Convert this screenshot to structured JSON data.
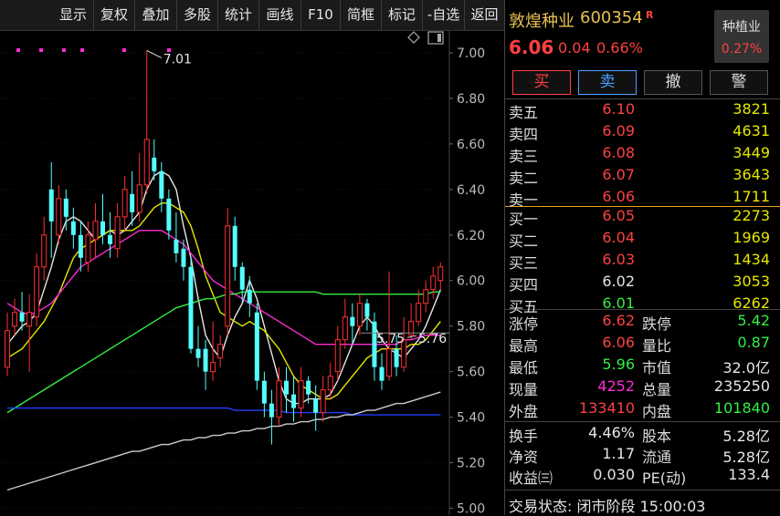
{
  "toolbar": {
    "items": [
      "显示",
      "复权",
      "叠加",
      "多股",
      "统计",
      "画线",
      "F10",
      "简框",
      "标记",
      "-自选",
      "返回"
    ]
  },
  "chart_data": {
    "type": "candlestick",
    "y_ticks": [
      "7.00",
      "6.80",
      "6.60",
      "6.40",
      "6.20",
      "6.00",
      "5.80",
      "5.60",
      "5.40",
      "5.20",
      "5.00"
    ],
    "ylim": [
      4.97,
      7.1
    ],
    "annotations": {
      "high_label": "7.01",
      "low_label_left": "5.75",
      "low_label_right": "5.76"
    },
    "candles": [
      {
        "o": 5.62,
        "c": 5.78,
        "h": 5.86,
        "l": 5.58
      },
      {
        "o": 5.8,
        "c": 5.86,
        "h": 5.92,
        "l": 5.76
      },
      {
        "o": 5.86,
        "c": 5.82,
        "h": 5.95,
        "l": 5.78
      },
      {
        "o": 5.8,
        "c": 5.86,
        "h": 5.94,
        "l": 5.6
      },
      {
        "o": 5.84,
        "c": 6.06,
        "h": 6.12,
        "l": 5.8
      },
      {
        "o": 6.06,
        "c": 6.2,
        "h": 6.28,
        "l": 6.0
      },
      {
        "o": 6.4,
        "c": 6.26,
        "h": 6.52,
        "l": 6.1
      },
      {
        "o": 6.2,
        "c": 6.36,
        "h": 6.42,
        "l": 6.16
      },
      {
        "o": 6.36,
        "c": 6.28,
        "h": 6.4,
        "l": 6.22
      },
      {
        "o": 6.26,
        "c": 6.2,
        "h": 6.32,
        "l": 6.14
      },
      {
        "o": 6.2,
        "c": 6.1,
        "h": 6.26,
        "l": 6.04
      },
      {
        "o": 6.08,
        "c": 6.2,
        "h": 6.26,
        "l": 6.04
      },
      {
        "o": 6.18,
        "c": 6.26,
        "h": 6.34,
        "l": 6.1
      },
      {
        "o": 6.26,
        "c": 6.2,
        "h": 6.38,
        "l": 6.16
      },
      {
        "o": 6.2,
        "c": 6.16,
        "h": 6.3,
        "l": 6.1
      },
      {
        "o": 6.14,
        "c": 6.28,
        "h": 6.34,
        "l": 6.1
      },
      {
        "o": 6.28,
        "c": 6.4,
        "h": 6.46,
        "l": 6.22
      },
      {
        "o": 6.38,
        "c": 6.3,
        "h": 6.48,
        "l": 6.24
      },
      {
        "o": 6.3,
        "c": 6.42,
        "h": 6.56,
        "l": 6.26
      },
      {
        "o": 6.42,
        "c": 6.62,
        "h": 7.01,
        "l": 6.38
      },
      {
        "o": 6.54,
        "c": 6.48,
        "h": 6.62,
        "l": 6.44
      },
      {
        "o": 6.48,
        "c": 6.36,
        "h": 6.52,
        "l": 6.3
      },
      {
        "o": 6.36,
        "c": 6.22,
        "h": 6.4,
        "l": 6.18
      },
      {
        "o": 6.18,
        "c": 6.12,
        "h": 6.3,
        "l": 6.08
      },
      {
        "o": 6.14,
        "c": 6.06,
        "h": 6.18,
        "l": 6.0
      },
      {
        "o": 6.06,
        "c": 5.7,
        "h": 6.1,
        "l": 5.68
      },
      {
        "o": 5.7,
        "c": 5.66,
        "h": 5.8,
        "l": 5.62
      },
      {
        "o": 5.7,
        "c": 5.6,
        "h": 5.74,
        "l": 5.52
      },
      {
        "o": 5.6,
        "c": 5.64,
        "h": 5.82,
        "l": 5.56
      },
      {
        "o": 5.66,
        "c": 5.72,
        "h": 5.76,
        "l": 5.62
      },
      {
        "o": 5.8,
        "c": 6.24,
        "h": 6.32,
        "l": 5.76
      },
      {
        "o": 6.24,
        "c": 6.06,
        "h": 6.28,
        "l": 6.0
      },
      {
        "o": 6.06,
        "c": 5.96,
        "h": 6.08,
        "l": 5.9
      },
      {
        "o": 5.96,
        "c": 5.9,
        "h": 6.02,
        "l": 5.84
      },
      {
        "o": 5.86,
        "c": 5.56,
        "h": 5.9,
        "l": 5.52
      },
      {
        "o": 5.56,
        "c": 5.46,
        "h": 5.6,
        "l": 5.4
      },
      {
        "o": 5.46,
        "c": 5.4,
        "h": 5.52,
        "l": 5.28
      },
      {
        "o": 5.4,
        "c": 5.56,
        "h": 5.62,
        "l": 5.36
      },
      {
        "o": 5.56,
        "c": 5.5,
        "h": 5.62,
        "l": 5.42
      },
      {
        "o": 5.5,
        "c": 5.44,
        "h": 5.58,
        "l": 5.38
      },
      {
        "o": 5.44,
        "c": 5.56,
        "h": 5.62,
        "l": 5.4
      },
      {
        "o": 5.56,
        "c": 5.5,
        "h": 5.58,
        "l": 5.46
      },
      {
        "o": 5.48,
        "c": 5.42,
        "h": 5.54,
        "l": 5.34
      },
      {
        "o": 5.42,
        "c": 5.52,
        "h": 5.58,
        "l": 5.38
      },
      {
        "o": 5.52,
        "c": 5.58,
        "h": 5.64,
        "l": 5.48
      },
      {
        "o": 5.6,
        "c": 5.74,
        "h": 5.8,
        "l": 5.56
      },
      {
        "o": 5.74,
        "c": 5.84,
        "h": 5.92,
        "l": 5.7
      },
      {
        "o": 5.84,
        "c": 5.8,
        "h": 5.9,
        "l": 5.72
      },
      {
        "o": 5.8,
        "c": 5.9,
        "h": 5.94,
        "l": 5.76
      },
      {
        "o": 5.9,
        "c": 5.84,
        "h": 5.92,
        "l": 5.78
      },
      {
        "o": 5.82,
        "c": 5.62,
        "h": 5.86,
        "l": 5.56
      },
      {
        "o": 5.62,
        "c": 5.56,
        "h": 5.68,
        "l": 5.52
      },
      {
        "o": 5.58,
        "c": 5.7,
        "h": 6.04,
        "l": 5.56
      },
      {
        "o": 5.7,
        "c": 5.62,
        "h": 5.76,
        "l": 5.58
      },
      {
        "o": 5.62,
        "c": 5.74,
        "h": 5.84,
        "l": 5.6
      },
      {
        "o": 5.76,
        "c": 5.82,
        "h": 5.9,
        "l": 5.74
      },
      {
        "o": 5.82,
        "c": 5.9,
        "h": 5.96,
        "l": 5.8
      },
      {
        "o": 5.9,
        "c": 5.96,
        "h": 6.0,
        "l": 5.86
      },
      {
        "o": 5.96,
        "c": 6.02,
        "h": 6.06,
        "l": 5.92
      },
      {
        "o": 6.0,
        "c": 6.06,
        "h": 6.08,
        "l": 5.96
      }
    ],
    "ma": [
      {
        "name": "MA5",
        "color": "#e6e6e6",
        "values": [
          5.72,
          5.76,
          5.8,
          5.82,
          5.86,
          5.96,
          6.06,
          6.18,
          6.26,
          6.28,
          6.26,
          6.22,
          6.18,
          6.2,
          6.22,
          6.2,
          6.22,
          6.26,
          6.3,
          6.4,
          6.46,
          6.48,
          6.46,
          6.4,
          6.24,
          6.1,
          5.92,
          5.76,
          5.7,
          5.66,
          5.76,
          5.84,
          5.9,
          6.0,
          5.92,
          5.8,
          5.68,
          5.56,
          5.48,
          5.46,
          5.46,
          5.48,
          5.48,
          5.48,
          5.5,
          5.56,
          5.64,
          5.72,
          5.8,
          5.84,
          5.8,
          5.74,
          5.7,
          5.68,
          5.66,
          5.7,
          5.74,
          5.8,
          5.88,
          5.96
        ]
      },
      {
        "name": "MA10",
        "color": "#e6e600",
        "values": [
          5.66,
          5.68,
          5.7,
          5.74,
          5.78,
          5.82,
          5.88,
          5.94,
          6.02,
          6.1,
          6.14,
          6.16,
          6.18,
          6.2,
          6.22,
          6.22,
          6.22,
          6.22,
          6.24,
          6.28,
          6.32,
          6.34,
          6.34,
          6.32,
          6.3,
          6.24,
          6.14,
          6.02,
          5.94,
          5.86,
          5.84,
          5.82,
          5.8,
          5.82,
          5.8,
          5.78,
          5.74,
          5.7,
          5.64,
          5.58,
          5.54,
          5.52,
          5.5,
          5.48,
          5.48,
          5.5,
          5.54,
          5.58,
          5.62,
          5.66,
          5.68,
          5.7,
          5.7,
          5.7,
          5.7,
          5.72,
          5.72,
          5.74,
          5.78,
          5.82
        ]
      },
      {
        "name": "MA20",
        "color": "#ff2bd6",
        "values": [
          5.9,
          5.88,
          5.86,
          5.85,
          5.86,
          5.88,
          5.9,
          5.94,
          5.98,
          6.02,
          6.06,
          6.08,
          6.1,
          6.12,
          6.14,
          6.16,
          6.18,
          6.2,
          6.22,
          6.22,
          6.22,
          6.22,
          6.2,
          6.18,
          6.16,
          6.12,
          6.08,
          6.04,
          6.0,
          5.98,
          5.96,
          5.94,
          5.92,
          5.9,
          5.88,
          5.86,
          5.84,
          5.82,
          5.8,
          5.78,
          5.76,
          5.74,
          5.72,
          5.72,
          5.72,
          5.72,
          5.72,
          5.72,
          5.72,
          5.72,
          5.72,
          5.72,
          5.72,
          5.72,
          5.74,
          5.74,
          5.75,
          5.76,
          5.76,
          5.76
        ]
      },
      {
        "name": "MA60",
        "color": "#33ee44",
        "values": [
          5.42,
          5.44,
          5.46,
          5.48,
          5.5,
          5.52,
          5.54,
          5.56,
          5.58,
          5.6,
          5.62,
          5.64,
          5.66,
          5.68,
          5.7,
          5.72,
          5.74,
          5.76,
          5.78,
          5.8,
          5.82,
          5.84,
          5.86,
          5.88,
          5.89,
          5.9,
          5.91,
          5.92,
          5.92,
          5.93,
          5.94,
          5.94,
          5.95,
          5.95,
          5.95,
          5.95,
          5.95,
          5.95,
          5.95,
          5.95,
          5.95,
          5.95,
          5.95,
          5.94,
          5.94,
          5.94,
          5.94,
          5.94,
          5.94,
          5.94,
          5.94,
          5.94,
          5.94,
          5.94,
          5.94,
          5.94,
          5.94,
          5.94,
          5.95,
          5.95
        ]
      },
      {
        "name": "MA120",
        "color": "#2040ff",
        "values": [
          5.44,
          5.44,
          5.44,
          5.44,
          5.44,
          5.44,
          5.44,
          5.44,
          5.44,
          5.44,
          5.44,
          5.44,
          5.44,
          5.44,
          5.44,
          5.44,
          5.44,
          5.44,
          5.44,
          5.44,
          5.44,
          5.44,
          5.44,
          5.44,
          5.44,
          5.44,
          5.44,
          5.44,
          5.44,
          5.44,
          5.44,
          5.43,
          5.43,
          5.43,
          5.43,
          5.43,
          5.43,
          5.43,
          5.42,
          5.42,
          5.42,
          5.42,
          5.42,
          5.42,
          5.42,
          5.42,
          5.42,
          5.41,
          5.41,
          5.41,
          5.41,
          5.41,
          5.41,
          5.41,
          5.41,
          5.41,
          5.41,
          5.41,
          5.41,
          5.41
        ]
      },
      {
        "name": "MA250",
        "color": "#cccccc",
        "values": [
          5.08,
          5.09,
          5.1,
          5.11,
          5.12,
          5.13,
          5.14,
          5.15,
          5.16,
          5.17,
          5.18,
          5.19,
          5.2,
          5.21,
          5.22,
          5.23,
          5.24,
          5.25,
          5.25,
          5.26,
          5.27,
          5.28,
          5.28,
          5.29,
          5.3,
          5.3,
          5.31,
          5.31,
          5.32,
          5.32,
          5.33,
          5.33,
          5.34,
          5.34,
          5.35,
          5.35,
          5.36,
          5.36,
          5.37,
          5.37,
          5.38,
          5.38,
          5.39,
          5.39,
          5.4,
          5.4,
          5.41,
          5.41,
          5.42,
          5.43,
          5.43,
          5.44,
          5.45,
          5.46,
          5.46,
          5.47,
          5.48,
          5.49,
          5.5,
          5.51
        ]
      }
    ]
  },
  "quote": {
    "name": "敦煌种业",
    "code": "600354",
    "badge": "R",
    "price": "6.06",
    "change": "0.04",
    "change_pct": "0.66%",
    "sector_name": "种植业",
    "sector_pct": "0.27%"
  },
  "buttons": {
    "buy": "买",
    "sell": "卖",
    "cancel": "撤",
    "alert": "警"
  },
  "asks": [
    {
      "label": "卖五",
      "price": "6.10",
      "vol": "3821"
    },
    {
      "label": "卖四",
      "price": "6.09",
      "vol": "4631"
    },
    {
      "label": "卖三",
      "price": "6.08",
      "vol": "3449"
    },
    {
      "label": "卖二",
      "price": "6.07",
      "vol": "3643"
    },
    {
      "label": "卖一",
      "price": "6.06",
      "vol": "1711"
    }
  ],
  "bids": [
    {
      "label": "买一",
      "price": "6.05",
      "vol": "2273"
    },
    {
      "label": "买二",
      "price": "6.04",
      "vol": "1969"
    },
    {
      "label": "买三",
      "price": "6.03",
      "vol": "1434"
    },
    {
      "label": "买四",
      "price": "6.02",
      "vol": "3053"
    },
    {
      "label": "买五",
      "price": "6.01",
      "vol": "6262"
    }
  ],
  "stats": {
    "limit_up_lbl": "涨停",
    "limit_up": "6.62",
    "limit_down_lbl": "跌停",
    "limit_down": "5.42",
    "high_lbl": "最高",
    "high": "6.06",
    "vol_ratio_lbl": "量比",
    "vol_ratio": "0.87",
    "low_lbl": "最低",
    "low": "5.96",
    "mktcap_lbl": "市值",
    "mktcap": "32.0亿",
    "cur_lbl": "现量",
    "cur": "4252",
    "total_lbl": "总量",
    "total": "235250",
    "outer_lbl": "外盘",
    "outer": "133410",
    "inner_lbl": "内盘",
    "inner": "101840"
  },
  "fund": {
    "turnover_lbl": "换手",
    "turnover": "4.46%",
    "equity_lbl": "股本",
    "equity": "5.28亿",
    "nav_lbl": "净资",
    "nav": "1.17",
    "float_lbl": "流通",
    "float": "5.28亿",
    "eps_lbl": "收益㈢",
    "eps": "0.030",
    "pe_lbl": "PE(动)",
    "pe": "133.4"
  },
  "status": "交易状态: 闭市阶段 15:00:03"
}
